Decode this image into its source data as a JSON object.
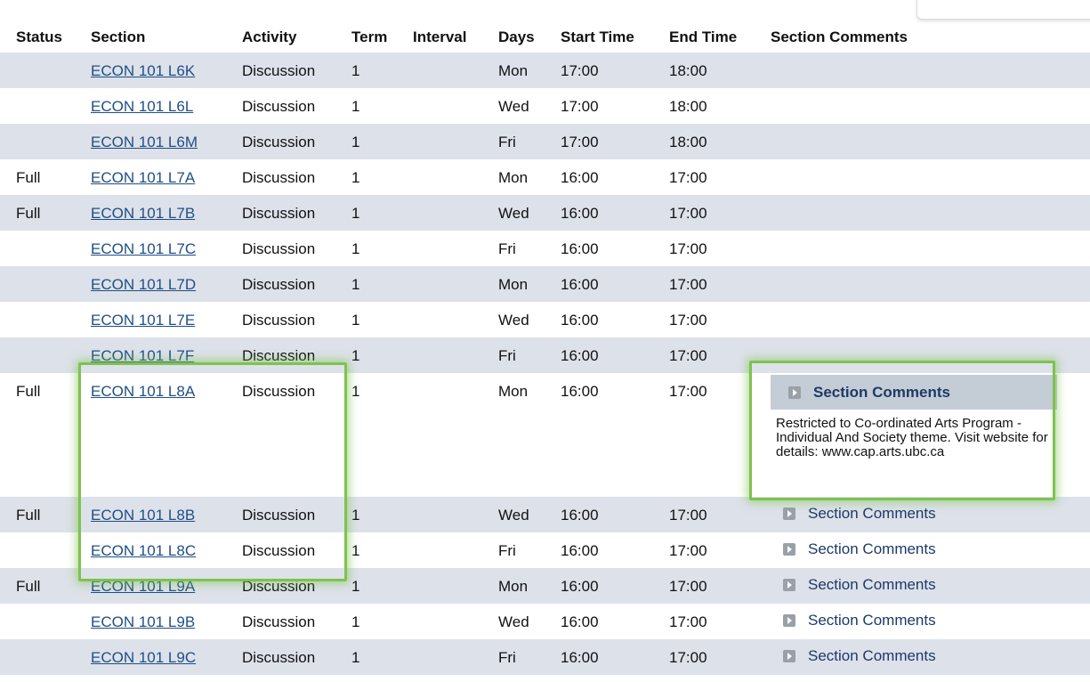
{
  "headers": [
    "Status",
    "Section",
    "Activity",
    "Term",
    "Interval",
    "Days",
    "Start Time",
    "End Time",
    "Section Comments"
  ],
  "rows": [
    {
      "status": "",
      "section": "ECON 101 L6K",
      "activity": "Discussion",
      "term": "1",
      "interval": "",
      "days": "Mon",
      "start": "17:00",
      "end": "18:00",
      "comments": ""
    },
    {
      "status": "",
      "section": "ECON 101 L6L",
      "activity": "Discussion",
      "term": "1",
      "interval": "",
      "days": "Wed",
      "start": "17:00",
      "end": "18:00",
      "comments": ""
    },
    {
      "status": "",
      "section": "ECON 101 L6M",
      "activity": "Discussion",
      "term": "1",
      "interval": "",
      "days": "Fri",
      "start": "17:00",
      "end": "18:00",
      "comments": ""
    },
    {
      "status": "Full",
      "section": "ECON 101 L7A",
      "activity": "Discussion",
      "term": "1",
      "interval": "",
      "days": "Mon",
      "start": "16:00",
      "end": "17:00",
      "comments": ""
    },
    {
      "status": "Full",
      "section": "ECON 101 L7B",
      "activity": "Discussion",
      "term": "1",
      "interval": "",
      "days": "Wed",
      "start": "16:00",
      "end": "17:00",
      "comments": ""
    },
    {
      "status": "",
      "section": "ECON 101 L7C",
      "activity": "Discussion",
      "term": "1",
      "interval": "",
      "days": "Fri",
      "start": "16:00",
      "end": "17:00",
      "comments": ""
    },
    {
      "status": "",
      "section": "ECON 101 L7D",
      "activity": "Discussion",
      "term": "1",
      "interval": "",
      "days": "Mon",
      "start": "16:00",
      "end": "17:00",
      "comments": ""
    },
    {
      "status": "",
      "section": "ECON 101 L7E",
      "activity": "Discussion",
      "term": "1",
      "interval": "",
      "days": "Wed",
      "start": "16:00",
      "end": "17:00",
      "comments": ""
    },
    {
      "status": "",
      "section": "ECON 101 L7F",
      "activity": "Discussion",
      "term": "1",
      "interval": "",
      "days": "Fri",
      "start": "16:00",
      "end": "17:00",
      "comments": ""
    },
    {
      "status": "Full",
      "section": "ECON 101 L8A",
      "activity": "Discussion",
      "term": "1",
      "interval": "",
      "days": "Mon",
      "start": "16:00",
      "end": "17:00",
      "comments": "Section Comments",
      "comment_expanded": true,
      "comment_text": "Restricted to Co-ordinated Arts Program - Individual And Society theme. Visit website for details: www.cap.arts.ubc.ca"
    },
    {
      "status": "Full",
      "section": "ECON 101 L8B",
      "activity": "Discussion",
      "term": "1",
      "interval": "",
      "days": "Wed",
      "start": "16:00",
      "end": "17:00",
      "comments": "Section Comments"
    },
    {
      "status": "",
      "section": "ECON 101 L8C",
      "activity": "Discussion",
      "term": "1",
      "interval": "",
      "days": "Fri",
      "start": "16:00",
      "end": "17:00",
      "comments": "Section Comments"
    },
    {
      "status": "Full",
      "section": "ECON 101 L9A",
      "activity": "Discussion",
      "term": "1",
      "interval": "",
      "days": "Mon",
      "start": "16:00",
      "end": "17:00",
      "comments": "Section Comments"
    },
    {
      "status": "",
      "section": "ECON 101 L9B",
      "activity": "Discussion",
      "term": "1",
      "interval": "",
      "days": "Wed",
      "start": "16:00",
      "end": "17:00",
      "comments": "Section Comments"
    },
    {
      "status": "",
      "section": "ECON 101 L9C",
      "activity": "Discussion",
      "term": "1",
      "interval": "",
      "days": "Fri",
      "start": "16:00",
      "end": "17:00",
      "comments": "Section Comments"
    }
  ],
  "colors": {
    "row_shade": "#dde1ea",
    "link": "#1f4f84",
    "comment_header": "#c4ccd6",
    "highlight": "#7ec24f"
  },
  "icons": {
    "comment_toggle": "expand-arrow-icon"
  }
}
